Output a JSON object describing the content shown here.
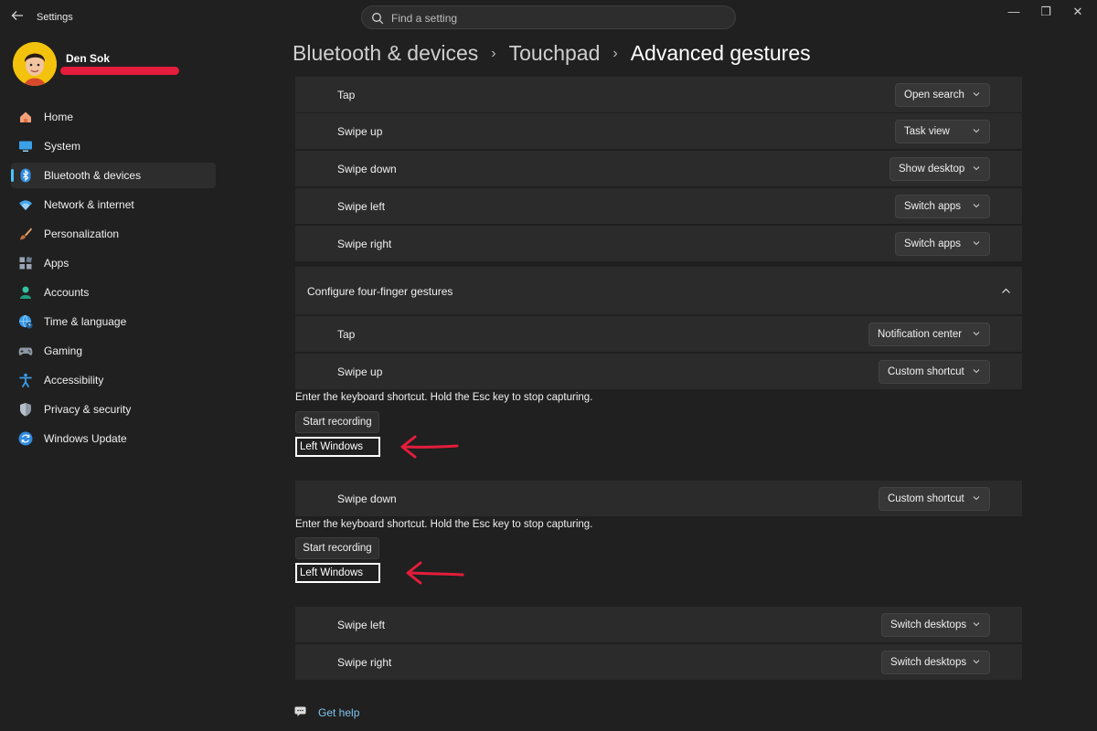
{
  "window": {
    "app_title": "Settings",
    "back_icon": "back-arrow-icon",
    "controls": {
      "minimize": "—",
      "restore": "❐",
      "close": "✕"
    }
  },
  "search": {
    "placeholder": "Find a setting",
    "icon": "search-icon"
  },
  "profile": {
    "name": "Den Sok",
    "redaction_color": "#e31d3b",
    "avatar_color": "#f3c20d"
  },
  "sidebar": {
    "items": [
      {
        "label": "Home",
        "icon": "home-icon"
      },
      {
        "label": "System",
        "icon": "monitor-icon"
      },
      {
        "label": "Bluetooth & devices",
        "icon": "bluetooth-icon",
        "active": true
      },
      {
        "label": "Network & internet",
        "icon": "wifi-icon"
      },
      {
        "label": "Personalization",
        "icon": "brush-icon"
      },
      {
        "label": "Apps",
        "icon": "apps-icon"
      },
      {
        "label": "Accounts",
        "icon": "account-icon"
      },
      {
        "label": "Time & language",
        "icon": "globe-clock-icon"
      },
      {
        "label": "Gaming",
        "icon": "gamepad-icon"
      },
      {
        "label": "Accessibility",
        "icon": "accessibility-icon"
      },
      {
        "label": "Privacy & security",
        "icon": "shield-icon"
      },
      {
        "label": "Windows Update",
        "icon": "update-icon"
      }
    ]
  },
  "breadcrumb": {
    "items": [
      "Bluetooth & devices",
      "Touchpad",
      "Advanced gestures"
    ],
    "separator": "›"
  },
  "three_finger": {
    "rows": [
      {
        "label": "Tap",
        "value": "Open search"
      },
      {
        "label": "Swipe up",
        "value": "Task view"
      },
      {
        "label": "Swipe down",
        "value": "Show desktop"
      },
      {
        "label": "Swipe left",
        "value": "Switch apps"
      },
      {
        "label": "Swipe right",
        "value": "Switch apps"
      }
    ]
  },
  "four_finger": {
    "header": "Configure four-finger gestures",
    "rows": [
      {
        "label": "Tap",
        "value": "Notification center"
      },
      {
        "label": "Swipe up",
        "value": "Custom shortcut"
      },
      {
        "label": "Swipe down",
        "value": "Custom shortcut"
      },
      {
        "label": "Swipe left",
        "value": "Switch desktops"
      },
      {
        "label": "Swipe right",
        "value": "Switch desktops"
      }
    ],
    "capture": {
      "hint": "Enter the keyboard shortcut. Hold the Esc key to stop capturing.",
      "record_label": "Start recording",
      "shortcut_value": "Left Windows"
    }
  },
  "annotation": {
    "arrow_color": "#e31d3b",
    "icon": "red-arrow-annotation"
  },
  "help": {
    "label": "Get help",
    "icon": "help-chat-icon"
  }
}
